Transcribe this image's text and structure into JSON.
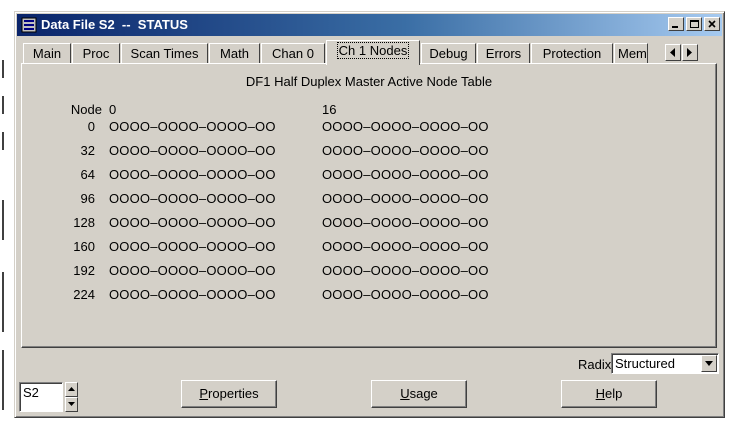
{
  "window": {
    "title": "Data File S2  --  STATUS",
    "icon": "data-file-icon",
    "caption_buttons": [
      "minimize-icon",
      "maximize-icon",
      "close-icon"
    ]
  },
  "tabs": [
    {
      "label": "Main",
      "active": false
    },
    {
      "label": "Proc",
      "active": false
    },
    {
      "label": "Scan Times",
      "active": false
    },
    {
      "label": "Math",
      "active": false
    },
    {
      "label": "Chan 0",
      "active": false
    },
    {
      "label": "Ch 1 Nodes",
      "active": true
    },
    {
      "label": "Debug",
      "active": false
    },
    {
      "label": "Errors",
      "active": false
    },
    {
      "label": "Protection",
      "active": false
    },
    {
      "label": "Mem",
      "active": false
    }
  ],
  "node_table": {
    "title": "DF1 Half Duplex Master Active Node Table",
    "header": {
      "label": "Node",
      "col1": "0",
      "col2": "16"
    },
    "rows": [
      {
        "label": "0",
        "bits1": "OOOO–OOOO–OOOO–OO",
        "bits2": "OOOO–OOOO–OOOO–OO"
      },
      {
        "label": "32",
        "bits1": "OOOO–OOOO–OOOO–OO",
        "bits2": "OOOO–OOOO–OOOO–OO"
      },
      {
        "label": "64",
        "bits1": "OOOO–OOOO–OOOO–OO",
        "bits2": "OOOO–OOOO–OOOO–OO"
      },
      {
        "label": "96",
        "bits1": "OOOO–OOOO–OOOO–OO",
        "bits2": "OOOO–OOOO–OOOO–OO"
      },
      {
        "label": "128",
        "bits1": "OOOO–OOOO–OOOO–OO",
        "bits2": "OOOO–OOOO–OOOO–OO"
      },
      {
        "label": "160",
        "bits1": "OOOO–OOOO–OOOO–OO",
        "bits2": "OOOO–OOOO–OOOO–OO"
      },
      {
        "label": "192",
        "bits1": "OOOO–OOOO–OOOO–OO",
        "bits2": "OOOO–OOOO–OOOO–OO"
      },
      {
        "label": "224",
        "bits1": "OOOO–OOOO–OOOO–OO",
        "bits2": "OOOO–OOOO–OOOO–OO"
      }
    ]
  },
  "radix": {
    "label": "Radix:",
    "value": "Structured"
  },
  "file_selector": {
    "value": "S2"
  },
  "buttons": {
    "properties": {
      "underline": "P",
      "rest": "roperties"
    },
    "usage": {
      "underline": "U",
      "rest": "sage"
    },
    "help": {
      "underline": "H",
      "rest": "elp"
    }
  },
  "colors": {
    "face": "#d4d0c8",
    "title_start": "#0a246a",
    "title_end": "#a6caf0"
  }
}
